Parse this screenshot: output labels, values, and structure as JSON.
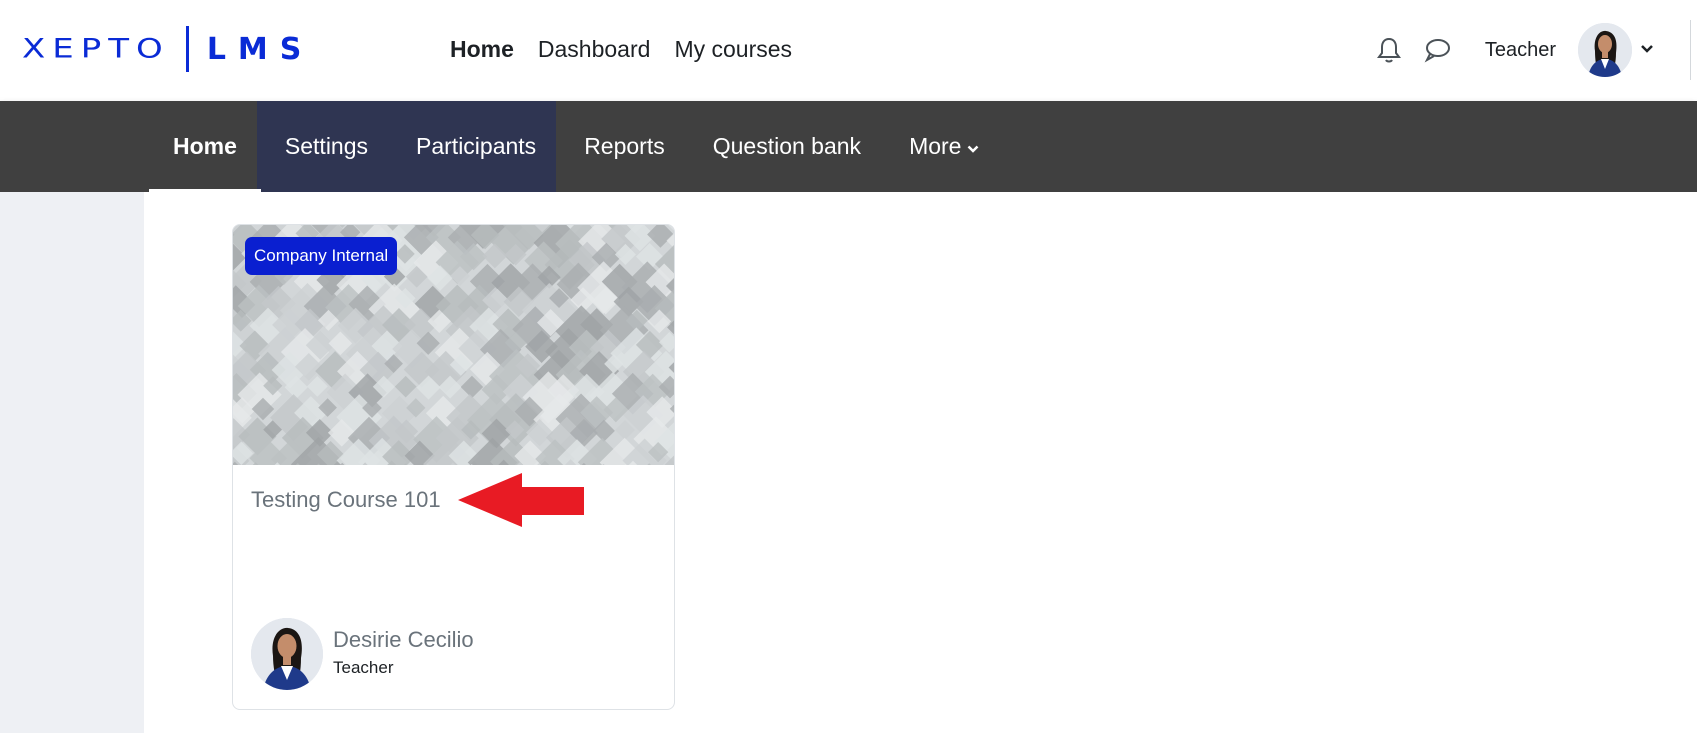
{
  "brand": {
    "logo_mark": "XEPTO",
    "logo_product": "LMS",
    "color": "#0a2bd6"
  },
  "primary_nav": {
    "items": [
      {
        "label": "Home",
        "active": true
      },
      {
        "label": "Dashboard",
        "active": false
      },
      {
        "label": "My courses",
        "active": false
      }
    ]
  },
  "user_menu": {
    "notifications_icon": "bell-icon",
    "messages_icon": "chat-bubble-icon",
    "user_name": "Teacher",
    "dropdown_icon": "chevron-down-icon"
  },
  "secondary_nav": {
    "items": [
      {
        "label": "Home",
        "active": true
      },
      {
        "label": "Settings",
        "active": false
      },
      {
        "label": "Participants",
        "active": false
      },
      {
        "label": "Reports",
        "active": false
      },
      {
        "label": "Question bank",
        "active": false
      },
      {
        "label": "More",
        "active": false
      }
    ],
    "bar_color": "#404040",
    "highlight_color": "#2f3552"
  },
  "course_card": {
    "badge": "Company Internal",
    "badge_color": "#0a1fd0",
    "title": "Testing Course 101",
    "annotation": "red-arrow-pointing-left",
    "teacher": {
      "name": "Desirie Cecilio",
      "role": "Teacher"
    }
  }
}
